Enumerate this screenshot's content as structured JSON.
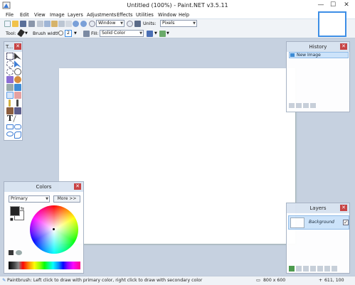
{
  "window": {
    "title": "Untitled (100%) - Paint.NET v3.5.11",
    "minimize": "—",
    "maximize": "☐",
    "close": "✕"
  },
  "menu": [
    "File",
    "Edit",
    "View",
    "Image",
    "Layers",
    "Adjustments",
    "Effects",
    "Utilities",
    "Window",
    "Help"
  ],
  "toolbar": {
    "zoom_select": "Window",
    "units_label": "Units:",
    "units_select": "Pixels",
    "tool_label": "Tool:",
    "brush_width_label": "Brush width:",
    "brush_width_value": "2",
    "fill_label": "Fill:",
    "fill_select": "Solid Color"
  },
  "tools_window": {
    "title": "T..."
  },
  "history": {
    "title": "History",
    "items": [
      "New Image"
    ]
  },
  "layers": {
    "title": "Layers",
    "items": [
      "Background"
    ]
  },
  "colors": {
    "title": "Colors",
    "mode_select": "Primary",
    "more_button": "More >>"
  },
  "status": {
    "hint": "Paintbrush: Left click to draw with primary color, right click to draw with secondary color",
    "image_size": "800 x 600",
    "cursor_pos": "611, 100"
  }
}
